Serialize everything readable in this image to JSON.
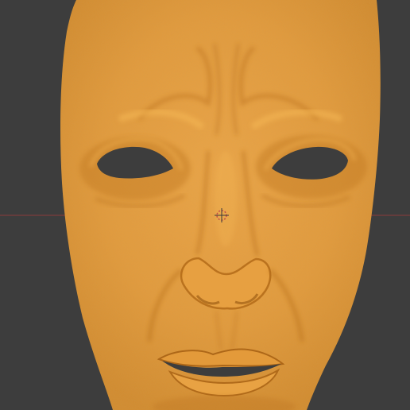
{
  "viewport": {
    "background_color": "#3d3d3d",
    "x_axis_color": "#8a3a3a"
  },
  "model": {
    "subject": "face-mask",
    "surface_color": "#e8a03e",
    "shadow_color": "#b86f1c",
    "highlight_color": "#f3b14e",
    "eye_hole_color": "#3d3d3d"
  },
  "cursor_3d": {
    "icon": "3d-cursor-icon"
  }
}
